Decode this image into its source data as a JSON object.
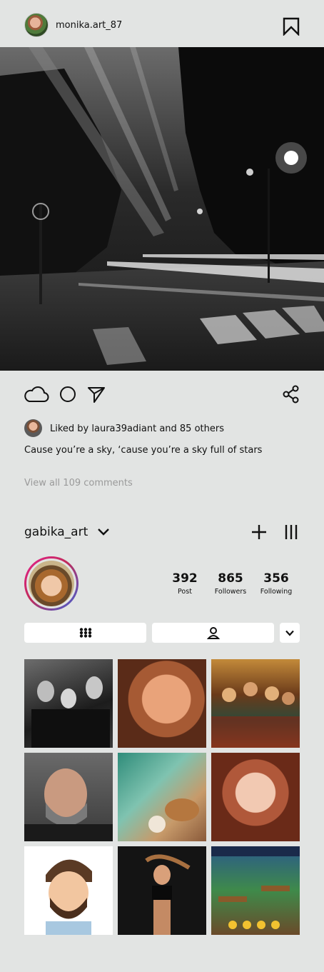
{
  "post": {
    "author_username": "monika.art_87",
    "liked_by_text": "Liked by laura39adiant and 85 others",
    "caption": "Cause you’re a sky, ‘cause you’re a sky full of stars",
    "view_comments": "View all 109 comments"
  },
  "profile": {
    "username": "gabika_art",
    "stats": [
      {
        "value": "392",
        "label": "Post"
      },
      {
        "value": "865",
        "label": "Followers"
      },
      {
        "value": "356",
        "label": "Following"
      }
    ]
  },
  "colors": {
    "background": "#e2e4e3",
    "story_ring_start": "#e5218c",
    "story_ring_end": "#3a63d9"
  },
  "icons": [
    "bookmark-icon",
    "cloud-like-icon",
    "comment-icon",
    "send-icon",
    "share-icon",
    "chevron-down-icon",
    "plus-icon",
    "menu-icon",
    "grid-icon",
    "tagged-icon"
  ]
}
